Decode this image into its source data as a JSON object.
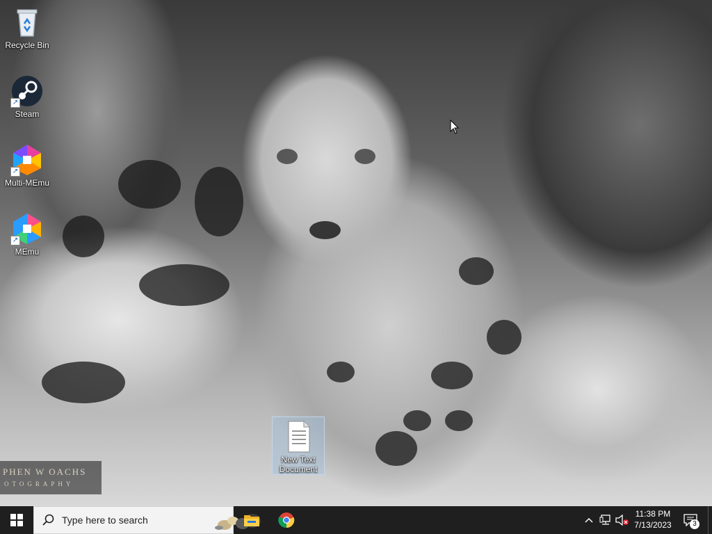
{
  "desktop": {
    "icons": [
      {
        "label": "Recycle Bin",
        "icon": "recycle-bin-icon"
      },
      {
        "label": "Steam",
        "icon": "steam-icon"
      },
      {
        "label": "Multi-MEmu",
        "icon": "multi-memu-icon"
      },
      {
        "label": "MEmu",
        "icon": "memu-icon"
      },
      {
        "label": "New Text Document",
        "icon": "text-document-icon"
      }
    ],
    "watermark": {
      "line1": "PHEN W OACHS",
      "line2": "OTOGRAPHY"
    }
  },
  "taskbar": {
    "search_placeholder": "Type here to search",
    "pinned": [
      {
        "name": "File Explorer",
        "icon": "file-explorer-icon"
      },
      {
        "name": "Google Chrome",
        "icon": "chrome-icon"
      }
    ],
    "clock": {
      "time": "11:38 PM",
      "date": "7/13/2023"
    },
    "notification_count": "3"
  },
  "colors": {
    "taskbar": "#1f1f1f",
    "start_accent": "#ffffff",
    "search_bg": "#f3f3f3"
  }
}
